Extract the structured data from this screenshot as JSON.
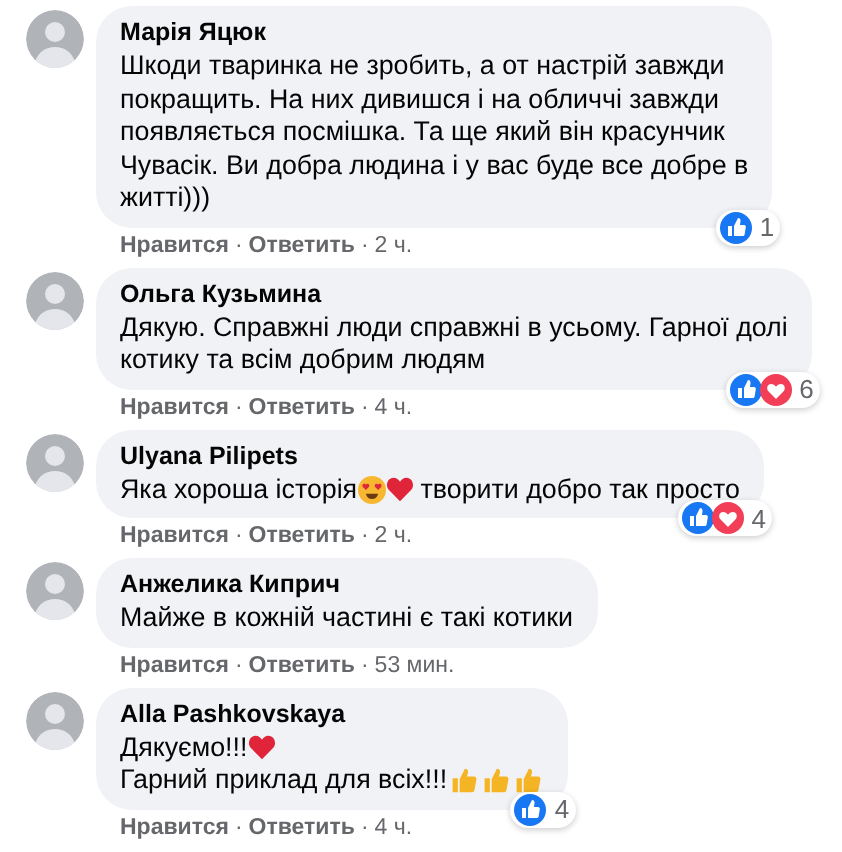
{
  "comments": [
    {
      "author": "Марія Яцюк",
      "lines": [
        [
          {
            "kind": "text",
            "text": "Шкоди тваринка не зробить, а от настрій завжди"
          }
        ],
        [
          {
            "kind": "text",
            "text": "покращить. На них дивишся і на обличчі завжди"
          }
        ],
        [
          {
            "kind": "text",
            "text": "появляється посмішка. Та ще який він красунчик"
          }
        ],
        [
          {
            "kind": "text",
            "text": "Чувасік. Ви добра людина і у вас буде все добре в"
          }
        ],
        [
          {
            "kind": "text",
            "text": "житті)))"
          }
        ]
      ],
      "actions": [
        "Нравится",
        "Ответить"
      ],
      "separator": "·",
      "time": "2 ч.",
      "reactions": [
        {
          "kind": "like"
        }
      ],
      "reaction_count": "1"
    },
    {
      "author": "Ольга Кузьмина",
      "lines": [
        [
          {
            "kind": "text",
            "text": "Дякую. Справжні люди справжні в усьому. Гарної долі"
          }
        ],
        [
          {
            "kind": "text",
            "text": "котику та всім добрим людям"
          }
        ]
      ],
      "actions": [
        "Нравится",
        "Ответить"
      ],
      "separator": "·",
      "time": "4 ч.",
      "reactions": [
        {
          "kind": "like"
        },
        {
          "kind": "love"
        }
      ],
      "reaction_count": "6"
    },
    {
      "author": "Ulyana Pilipets",
      "lines": [
        [
          {
            "kind": "text",
            "text": "Яка хороша історія"
          },
          {
            "kind": "heart-eyes"
          },
          {
            "kind": "heart"
          },
          {
            "kind": "text",
            "text": " творити добро так просто"
          }
        ]
      ],
      "actions": [
        "Нравится",
        "Ответить"
      ],
      "separator": "·",
      "time": "2 ч.",
      "reactions": [
        {
          "kind": "like"
        },
        {
          "kind": "love"
        }
      ],
      "reaction_count": "4"
    },
    {
      "author": "Анжелика Киприч",
      "lines": [
        [
          {
            "kind": "text",
            "text": "Майже в кожній частині є такі котики"
          }
        ]
      ],
      "actions": [
        "Нравится",
        "Ответить"
      ],
      "separator": "·",
      "time": "53 мин."
    },
    {
      "author": "Alla Pashkovskaya",
      "lines": [
        [
          {
            "kind": "text",
            "text": "Дякуємо!!!"
          },
          {
            "kind": "heart"
          }
        ],
        [
          {
            "kind": "text",
            "text": "Гарний приклад для всіх!!!"
          },
          {
            "kind": "thumb"
          },
          {
            "kind": "thumb"
          },
          {
            "kind": "thumb"
          }
        ]
      ],
      "actions": [
        "Нравится",
        "Ответить"
      ],
      "separator": "·",
      "time": "4 ч.",
      "reactions": [
        {
          "kind": "like"
        }
      ],
      "reaction_count": "4"
    }
  ]
}
